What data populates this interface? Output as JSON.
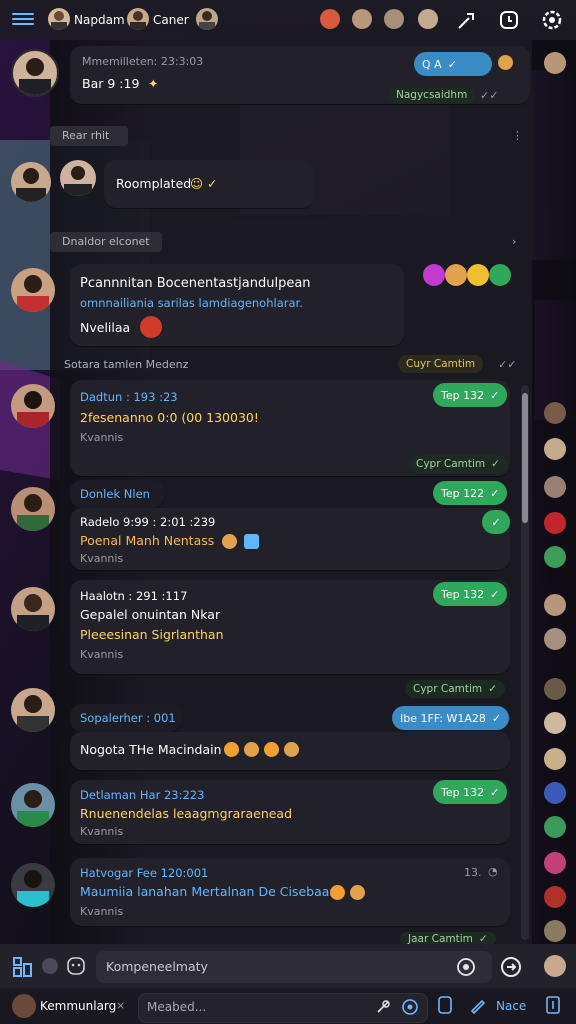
{
  "topbar": {
    "name_1": "Napdam",
    "name_2": "Caner"
  },
  "messages": {
    "m1": {
      "meta": "Mmemilleten: 23:3:03",
      "text": "Bar 9 :19",
      "pill": "Q A",
      "status": "Nagycsaidhm"
    },
    "sep1": "Rear rhit",
    "m2": {
      "text": "Roomplated"
    },
    "sep2": "Dnaldor elconet",
    "m3": {
      "title": "Pcannnitan Bocenentastjandulpean",
      "link": "omnnailiania sarilas lamdiagenohlarar.",
      "sub": "Nvelilaa"
    },
    "sep3": "Sotara tamlen Medenz",
    "sep3_pill": "Cuyr Camtim",
    "m4": {
      "meta": "Dadtun : 193 :23",
      "line": "2fesenanno 0:0 (00 130030!",
      "sub": "Kvannis",
      "pill": "Tep 132",
      "status": "Cypr Camtim"
    },
    "m5": {
      "name": "Donlek Nlen",
      "meta": "Radelo 9:99 : 2:01 :239",
      "line": "Poenal Manh Nentass",
      "sub": "Kvannis",
      "pill": "Tep 122"
    },
    "m6": {
      "meta": "Haalotn : 291 :117",
      "line1": "Gepalel onuintan Nkar",
      "line2": "Pleeesinan Sigrlanthan",
      "sub": "Kvannis",
      "pill": "Tep 132",
      "status": "Cypr Camtim"
    },
    "m7": {
      "name": "Sopalerher : 001",
      "line": "Nogota THe Macindain",
      "pill": "Ibe 1FF: W1A28"
    },
    "m8": {
      "meta": "Detlaman Har 23:223",
      "line": "Rnuenendelas leaagmgraraenead",
      "sub": "Kvannis",
      "pill": "Tep 132"
    },
    "m9": {
      "meta": "Hatvogar Fee 120:001",
      "line": "Maumiia lanahan Mertalnan De Cisebaar",
      "sub": "Kvannis",
      "count": "13."
    },
    "last_status": "Jaar Camtim"
  },
  "composer": {
    "placeholder": "Kompeneelmaty",
    "footer_name": "Kemmunlarg",
    "search_placeholder": "Meabed...",
    "right_label": "Nace"
  },
  "colors": {
    "accent_green": "#2fa85c",
    "accent_blue": "#5fb7ff",
    "bubble": "#22212a"
  },
  "icons": [
    "menu-icon",
    "sword-icon",
    "timer-icon",
    "settings-icon",
    "grid-icon",
    "emoji-icon",
    "send-icon",
    "camera-icon",
    "pencil-icon",
    "book-icon"
  ]
}
